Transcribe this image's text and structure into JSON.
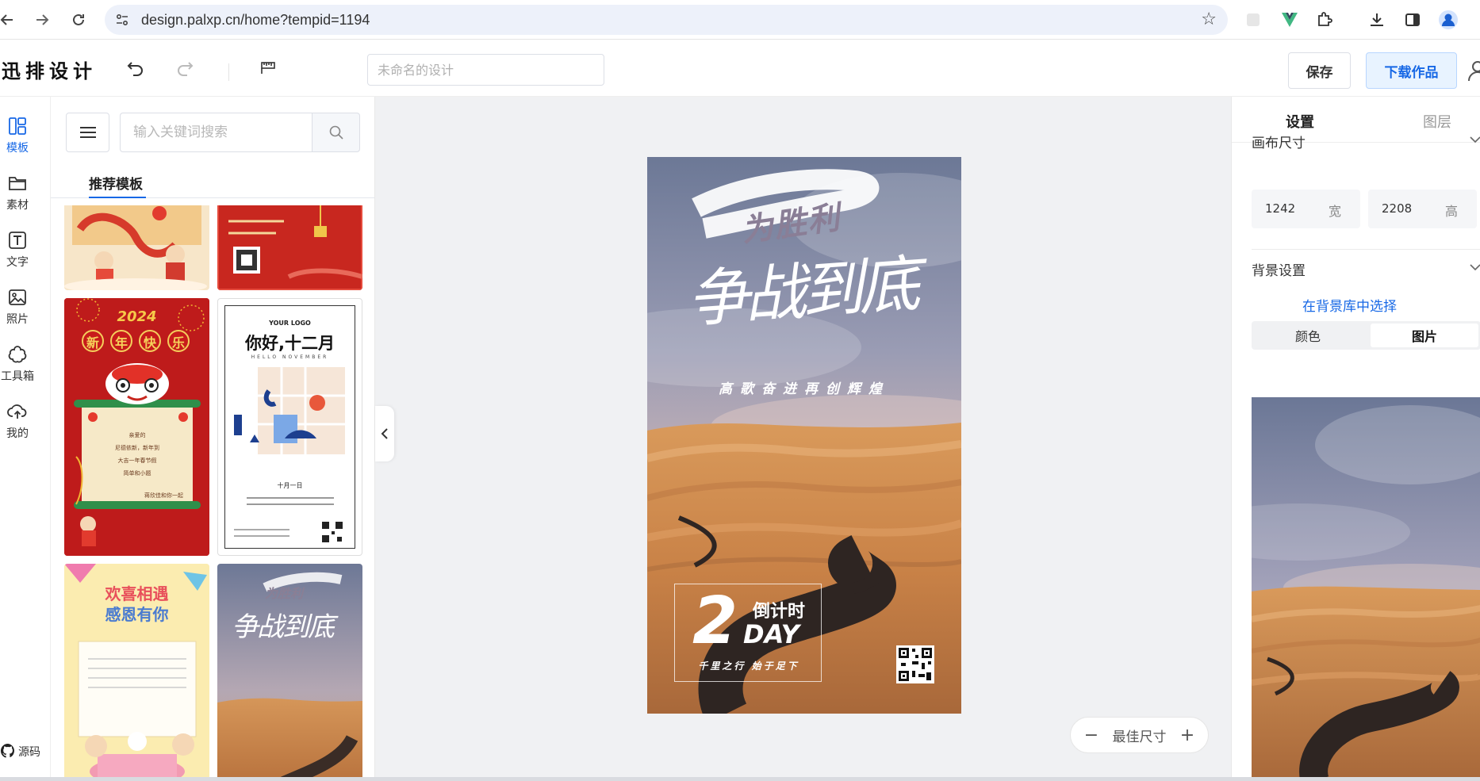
{
  "browser": {
    "url": "design.palxp.cn/home?tempid=1194",
    "back_icon": "arrow-left-icon",
    "forward_icon": "arrow-right-icon",
    "reload_icon": "reload-icon"
  },
  "app": {
    "logo": "迅排设计",
    "title_placeholder": "未命名的设计",
    "save_label": "保存",
    "download_label": "下载作品"
  },
  "rail": {
    "items": [
      {
        "label": "模板",
        "icon": "template-icon",
        "active": true
      },
      {
        "label": "素材",
        "icon": "folder-icon"
      },
      {
        "label": "文字",
        "icon": "text-icon"
      },
      {
        "label": "照片",
        "icon": "photo-icon"
      },
      {
        "label": "工具箱",
        "icon": "toolbox-icon"
      },
      {
        "label": "我的",
        "icon": "cloud-upload-icon"
      }
    ],
    "source_label": "源码"
  },
  "panel": {
    "search_placeholder": "输入关键词搜索",
    "section_title": "推荐模板",
    "thumbs": {
      "t3": {
        "year": "2024",
        "chars": [
          "新",
          "年",
          "快",
          "乐"
        ],
        "lines": [
          "亲爱的",
          "尼德依新，新年到",
          "大吉一年春节假",
          "简单和小题"
        ],
        "sign": "蒋欣佳和你一起"
      },
      "t4": {
        "logo": "YOUR LOGO",
        "title": "你好,十二月",
        "sub": "HELLO NOVEMBER",
        "caption": "十月一日"
      },
      "t5": {
        "title1": "欢喜相遇",
        "title2": "感恩有你"
      },
      "t6": {
        "title": "为胜利",
        "main": "争战到底"
      }
    }
  },
  "poster": {
    "brush_text": "为胜利",
    "main_text": "争战到底",
    "subtitle": "高歌奋进再创辉煌",
    "countdown_number": "2",
    "countdown_label": "倒计时",
    "countdown_unit": "DAY",
    "countdown_motto": "千里之行 始于足下"
  },
  "zoom": {
    "label": "最佳尺寸",
    "minus": "−",
    "plus": "+"
  },
  "settings": {
    "tab_settings": "设置",
    "tab_layers": "图层",
    "canvas_size_label": "画布尺寸",
    "width_value": "1242",
    "width_unit": "宽",
    "height_value": "2208",
    "height_unit": "高",
    "background_label": "背景设置",
    "bg_library_link": "在背景库中选择",
    "seg_color": "颜色",
    "seg_image": "图片"
  },
  "colors": {
    "accent": "#1768e6",
    "sand": "#d69452",
    "sky": "#7a86a8"
  }
}
